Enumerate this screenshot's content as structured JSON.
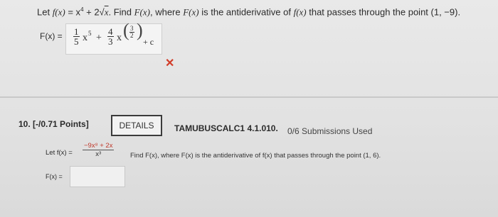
{
  "question9": {
    "prompt_start": "Let ",
    "fx": "f(x)",
    "eq": " = x",
    "exp4": "4",
    "plus": " + 2√",
    "x": "x",
    "prompt_end": ". Find ",
    "Fx": "F(x)",
    "where": ", where ",
    "Fx2": "F(x)",
    "anti": " is the antiderivative of ",
    "fx2": "f(x)",
    "passes": " that passes through the point (1, −9).",
    "answer_label": "F(x) =",
    "frac1_num": "1",
    "frac1_den": "5",
    "term1_var": "x",
    "term1_exp": "5",
    "plus_sign": "+",
    "frac2_num": "4",
    "frac2_den": "3",
    "term2_var": "x",
    "exp_frac_num": "3",
    "exp_frac_den": "2",
    "const": "+ c",
    "status_mark": "✕"
  },
  "question10": {
    "number": "10.",
    "points": "[-/0.71 Points]",
    "details_label": "DETAILS",
    "course_code": "TAMUBUSCALC1 4.1.010.",
    "submissions": "0/6 Submissions Used",
    "let": "Let f(x) =",
    "frac_num": "−9x⁸ + 2x",
    "frac_den": "x³",
    "rest": "Find F(x), where F(x) is the antiderivative of f(x) that passes through the point (1, 6).",
    "answer_label": "F(x) =",
    "answer_value": ""
  },
  "colors": {
    "error": "#d23c28"
  }
}
